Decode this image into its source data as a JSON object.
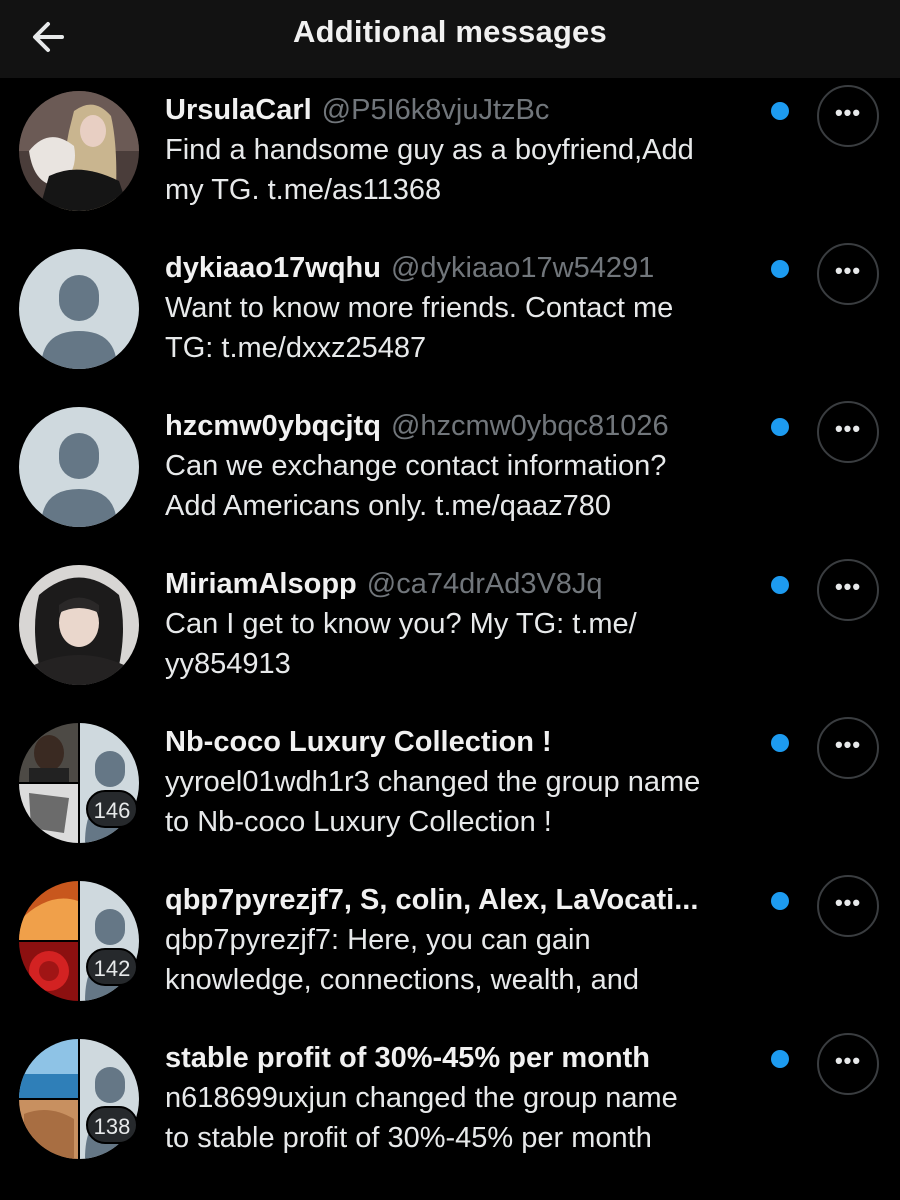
{
  "header": {
    "title": "Additional messages",
    "back_icon": "arrow-left-icon"
  },
  "colors": {
    "background": "#000000",
    "header_bg": "#121212",
    "unread_dot": "#1d9bf0",
    "handle": "#71767b"
  },
  "conversations": [
    {
      "name": "UrsulaCarl",
      "handle": "@P5I6k8vjuJtzBc",
      "message_line1": "Find a handsome guy as a boyfriend,Add",
      "message_line2": "my TG.  t.me/as11368",
      "avatar": "photo-woman-with-cat",
      "unread": true
    },
    {
      "name": "dykiaao17wqhu",
      "handle": "@dykiaao17w54291",
      "message_line1": "Want to know more friends. Contact me",
      "message_line2": "TG: t.me/dxxz25487",
      "avatar": "default-avatar",
      "unread": true
    },
    {
      "name": "hzcmw0ybqcjtq",
      "handle": "@hzcmw0ybqc81026",
      "message_line1": "Can we exchange contact information?",
      "message_line2": "Add Americans only.  t.me/qaaz780",
      "avatar": "default-avatar",
      "unread": true
    },
    {
      "name": "MiriamAlsopp",
      "handle": "@ca74drAd3V8Jq",
      "message_line1": "Can I get to know you? My TG: t.me/",
      "message_line2": "yy854913",
      "avatar": "photo-woman-hooded",
      "unread": true
    },
    {
      "name": "Nb-coco Luxury Collection !",
      "handle": "",
      "message_line1": "yyroel01wdh1r3 changed the group name",
      "message_line2": "to Nb-coco Luxury Collection !",
      "avatar": "group-avatar",
      "member_count": "146",
      "unread": true
    },
    {
      "name": "qbp7pyrezjf7, S, colin, Alex, LaVocati...",
      "handle": "",
      "message_line1": "qbp7pyrezjf7: Here, you can gain",
      "message_line2": "knowledge, connections, wealth, and",
      "avatar": "group-avatar",
      "member_count": "142",
      "unread": true
    },
    {
      "name": "stable profit of 30%-45% per month",
      "handle": "",
      "message_line1": "n618699uxjun changed the group name",
      "message_line2": "to stable profit of 30%-45% per month",
      "avatar": "group-avatar",
      "member_count": "138",
      "unread": true
    }
  ],
  "more_button_label": "•••"
}
